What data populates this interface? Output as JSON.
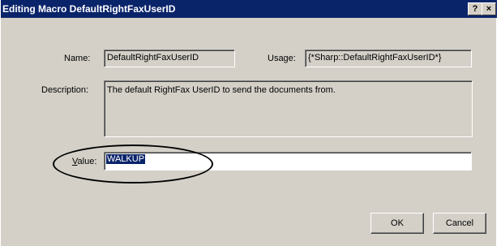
{
  "window": {
    "title": "Editing Macro DefaultRightFaxUserID",
    "help_button": "?",
    "close_button": "×"
  },
  "form": {
    "name_label": "Name:",
    "name_value": "DefaultRightFaxUserID",
    "usage_label": "Usage:",
    "usage_value": "{*Sharp::DefaultRightFaxUserID*}",
    "description_label": "Description:",
    "description_value": "The default RightFax UserID to send the documents from.",
    "value_label_accel": "V",
    "value_label_rest": "alue:",
    "value_value": "WALKUP"
  },
  "buttons": {
    "ok_label": "OK",
    "cancel_label": "Cancel"
  }
}
